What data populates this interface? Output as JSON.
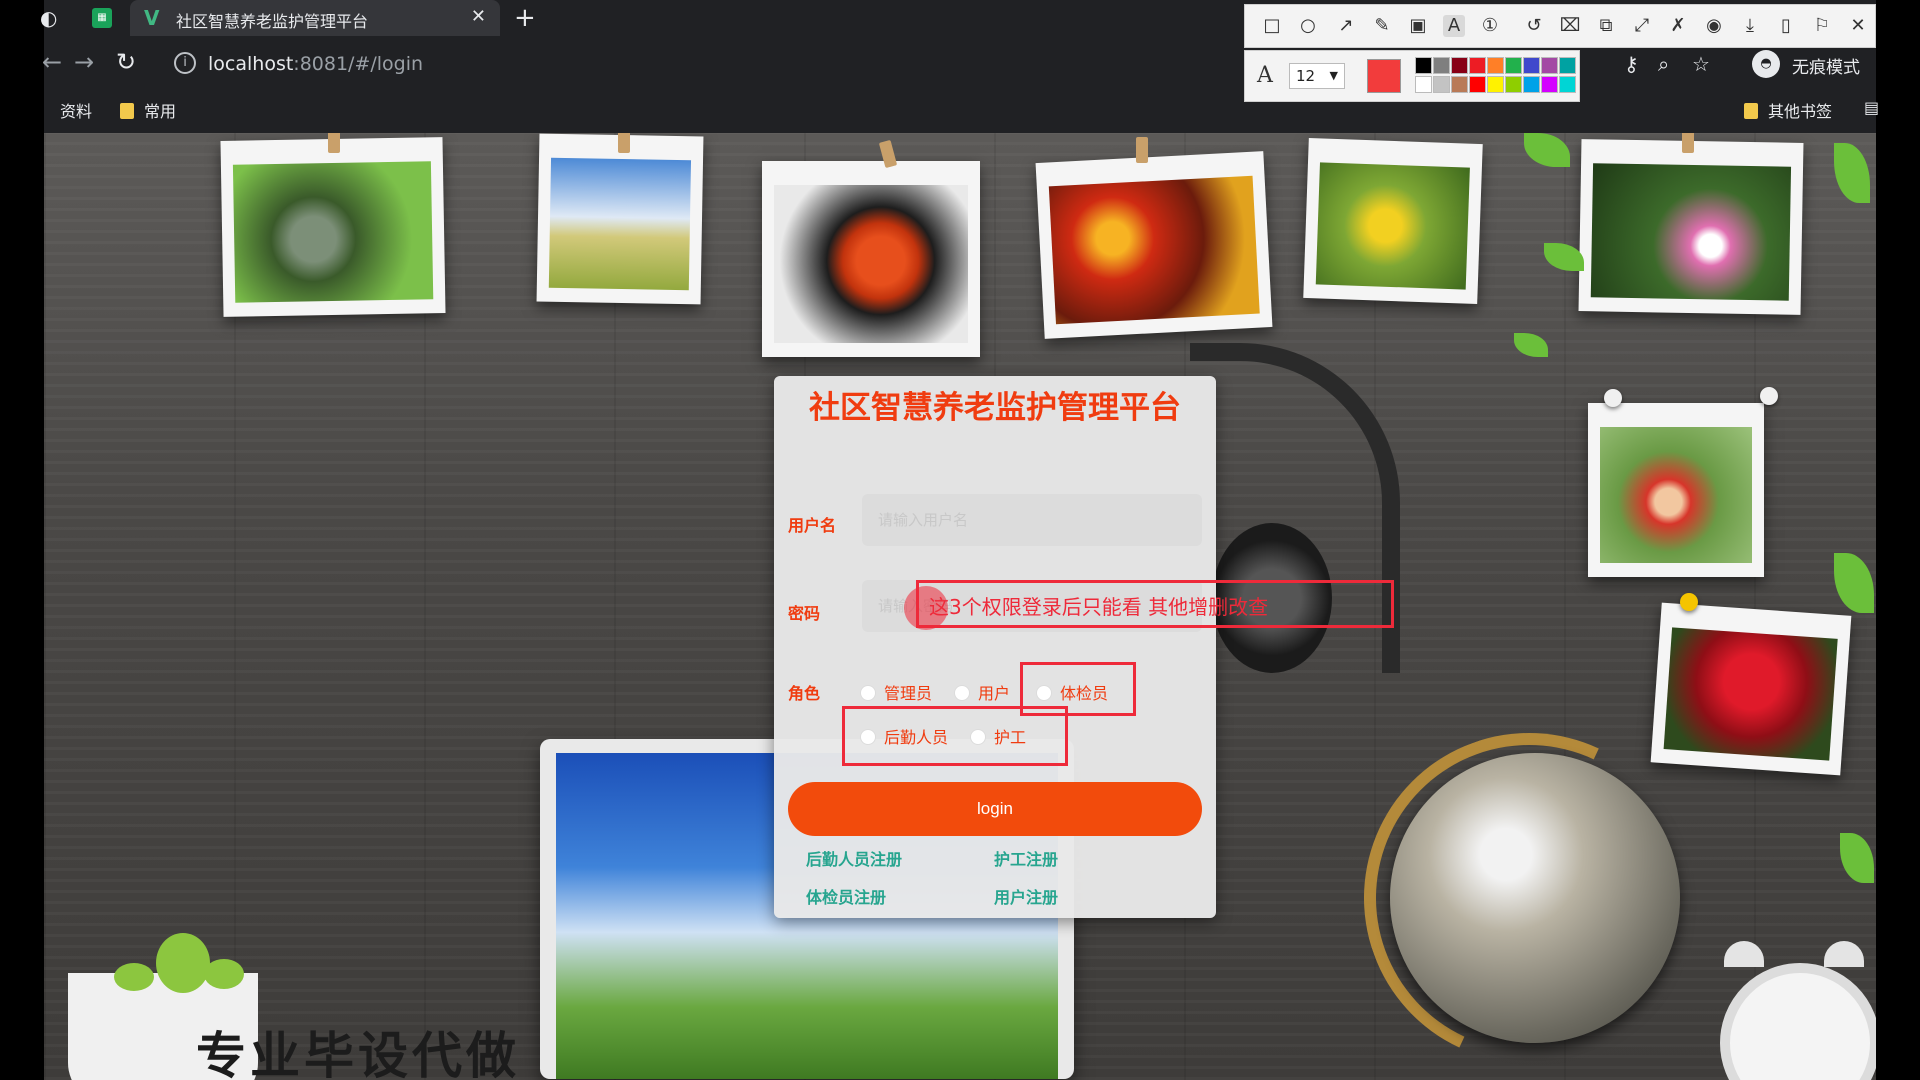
{
  "browser": {
    "tab_title": "社区智慧养老监护管理平台",
    "url_host": "localhost",
    "url_rest": ":8081/#/login",
    "incognito_label": "无痕模式",
    "bookmarks": [
      "资料",
      "常用"
    ],
    "other_bookmarks": "其他书签"
  },
  "annotation_tool": {
    "font_size": "12",
    "current_color": "#f23c3c",
    "palette": [
      "#000000",
      "#7f7f7f",
      "#880015",
      "#ed1c24",
      "#ff7f27",
      "#22b14c",
      "#3f48cc",
      "#a349a4",
      "#00a2a2",
      "#ffffff",
      "#c3c3c3",
      "#b97a57",
      "#ff0000",
      "#fff200",
      "#8fce00",
      "#00a2e8",
      "#d400ff",
      "#00d5d5"
    ]
  },
  "login": {
    "title": "社区智慧养老监护管理平台",
    "username_label": "用户名",
    "username_placeholder": "请输入用户名",
    "password_label": "密码",
    "password_placeholder": "请输入密码",
    "role_label": "角色",
    "roles": [
      "管理员",
      "用户",
      "体检员",
      "后勤人员",
      "护工"
    ],
    "login_button": "login",
    "register_links": [
      "后勤人员注册",
      "护工注册",
      "体检员注册",
      "用户注册"
    ]
  },
  "annotation_note": "这3个权限登录后只能看 其他增删改查",
  "background_caption": "专业毕设代做",
  "colors": {
    "accent": "#f03c10",
    "button": "#f24b0c",
    "link": "#27a58f",
    "annotation": "#ee2a3a"
  }
}
